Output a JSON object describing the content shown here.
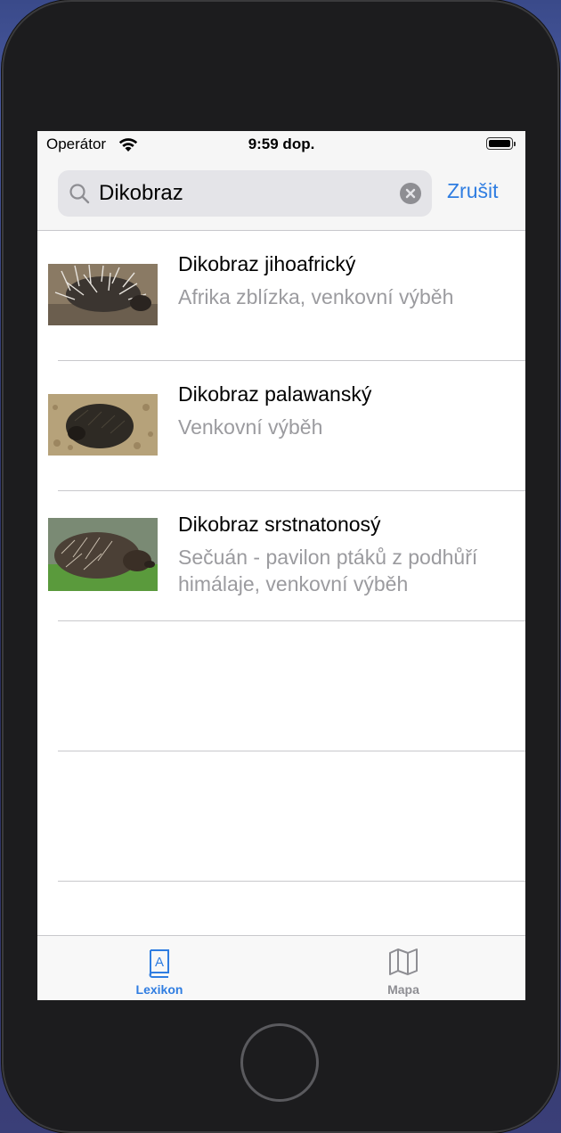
{
  "status_bar": {
    "carrier": "Operátor",
    "time": "9:59 dop."
  },
  "search": {
    "query": "Dikobraz",
    "cancel_label": "Zrušit"
  },
  "results": [
    {
      "title": "Dikobraz jihoafrický",
      "subtitle": "Afrika zblízka, venkovní výběh"
    },
    {
      "title": "Dikobraz palawanský",
      "subtitle": "Venkovní výběh"
    },
    {
      "title": "Dikobraz srstnatonosý",
      "subtitle": "Sečuán - pavilon ptáků z podhůří himálaje, venkovní výběh"
    }
  ],
  "tabs": [
    {
      "label": "Lexikon",
      "icon": "book-icon",
      "active": true
    },
    {
      "label": "Mapa",
      "icon": "map-icon",
      "active": false
    }
  ],
  "colors": {
    "accent": "#2f7de1",
    "inactive_tab": "#8e8e93",
    "subtitle": "#9b9b9f"
  }
}
